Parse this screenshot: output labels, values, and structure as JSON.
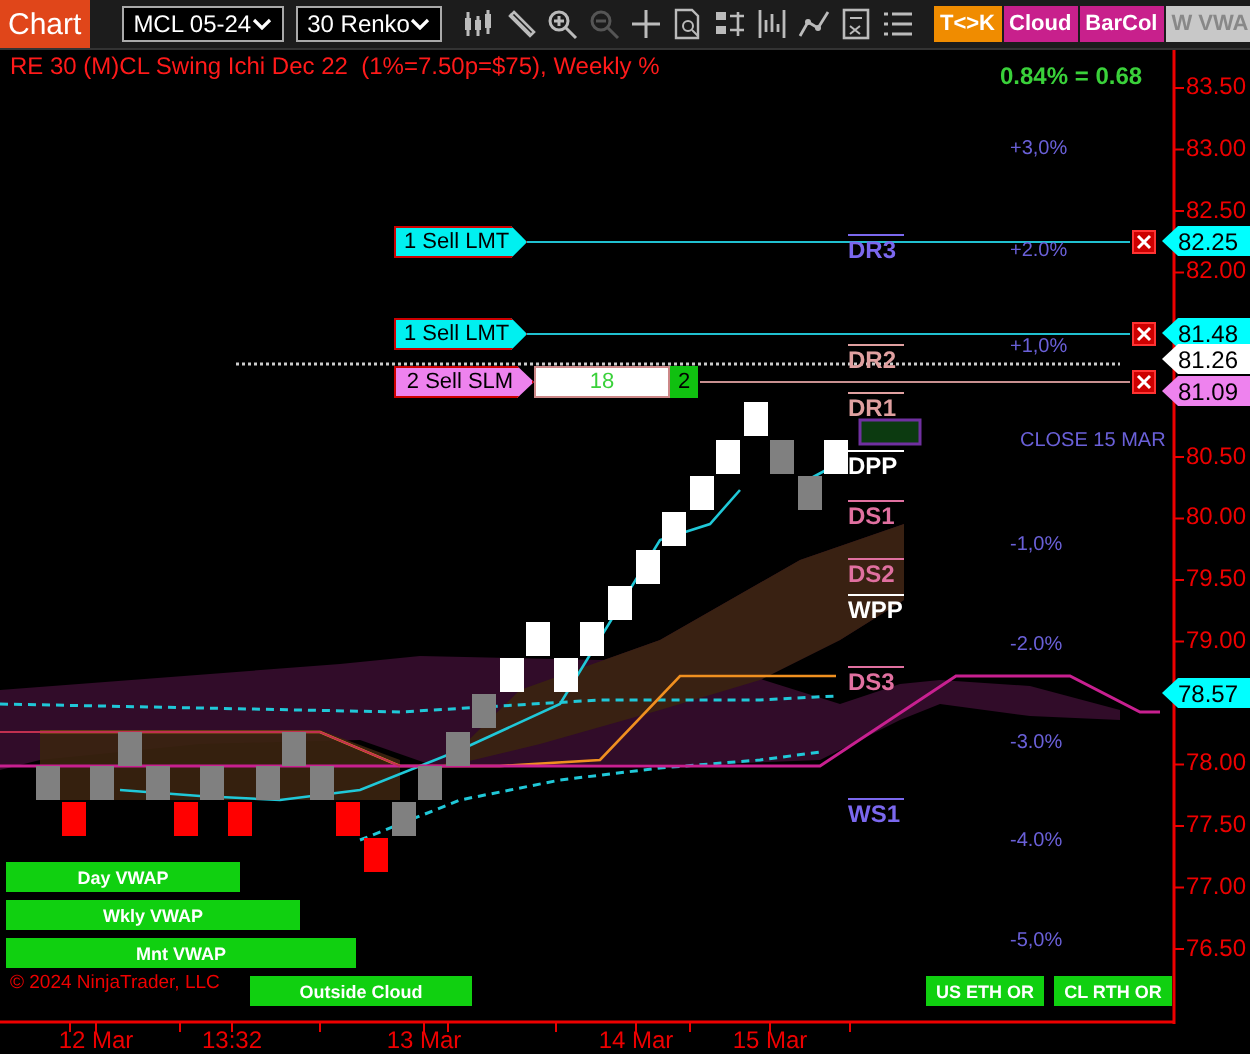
{
  "toolbar": {
    "app_button": "Chart",
    "instrument": "MCL 05-24",
    "bar_type": "30 Renko",
    "tools": [
      {
        "kind": "bars",
        "disabled": false
      },
      {
        "kind": "pencil",
        "disabled": false
      },
      {
        "kind": "zoom-in",
        "disabled": false
      },
      {
        "kind": "zoom-out",
        "disabled": true
      },
      {
        "kind": "crosshair",
        "disabled": false
      },
      {
        "kind": "doc",
        "disabled": false
      },
      {
        "kind": "bars2",
        "disabled": false
      },
      {
        "kind": "chart",
        "disabled": false
      },
      {
        "kind": "line",
        "disabled": false
      },
      {
        "kind": "calc",
        "disabled": false
      },
      {
        "kind": "list",
        "disabled": false
      }
    ],
    "toggles": [
      {
        "label": "T<>K",
        "color": "#f08c00"
      },
      {
        "label": "Cloud",
        "color": "#c8208c"
      },
      {
        "label": "BarCol",
        "color": "#c8208c"
      },
      {
        "label": "W VWA",
        "color": "#c8c8c8"
      }
    ]
  },
  "chart": {
    "title": "RE 30 (M)CL Swing Ichi Dec 22  (1%=7.50p=$75), Weekly %",
    "readout": "0.84% = 0.68",
    "percent_labels": [
      "+3,0%",
      "+2.0%",
      "+1,0%",
      "-1,0%",
      "-2.0%",
      "-3.0%",
      "-4.0%",
      "-5,0%"
    ],
    "price_axis": [
      "83.50",
      "83.00",
      "82.50",
      "82.00",
      "80.50",
      "80.00",
      "79.50",
      "79.00",
      "78.00",
      "77.50",
      "77.00",
      "76.50"
    ],
    "time_axis": [
      "12 Mar",
      "13:32",
      "13 Mar",
      "14 Mar",
      "15 Mar"
    ],
    "orders": [
      {
        "kind": "limit",
        "label": "1 Sell LMT"
      },
      {
        "kind": "limit",
        "label": "1 Sell LMT"
      },
      {
        "kind": "stop",
        "label": "2 Sell SLM",
        "quantity": "18",
        "count": "2"
      }
    ],
    "price_markers": [
      {
        "price": "82.25",
        "color": "#00ffff"
      },
      {
        "price": "81.48",
        "color": "#00ffff"
      },
      {
        "price": "81.26",
        "color": "#ffffff"
      },
      {
        "price": "81.09",
        "color": "#ee82ee"
      },
      {
        "price": "78.57",
        "color": "#00ffff"
      }
    ],
    "pivots": [
      {
        "label": "DR3",
        "color": "#7b68ee"
      },
      {
        "label": "DR2",
        "color": "#e0a0a0"
      },
      {
        "label": "DR1",
        "color": "#e0a0a0"
      },
      {
        "label": "DPP",
        "color": "#ffffff"
      },
      {
        "label": "DS1",
        "color": "#e070a0"
      },
      {
        "label": "DS2",
        "color": "#e070a0"
      },
      {
        "label": "WPP",
        "color": "#ffffff"
      },
      {
        "label": "DS3",
        "color": "#e070a0"
      },
      {
        "label": "WS1",
        "color": "#7b68ee"
      }
    ],
    "close_label": "CLOSE 15 MAR",
    "indicator_buttons": [
      "Day VWAP",
      "Wkly VWAP",
      "Mnt VWAP",
      "Outside Cloud",
      "US ETH OR",
      "CL RTH OR"
    ],
    "copyright": "© 2024 NinjaTrader, LLC"
  }
}
